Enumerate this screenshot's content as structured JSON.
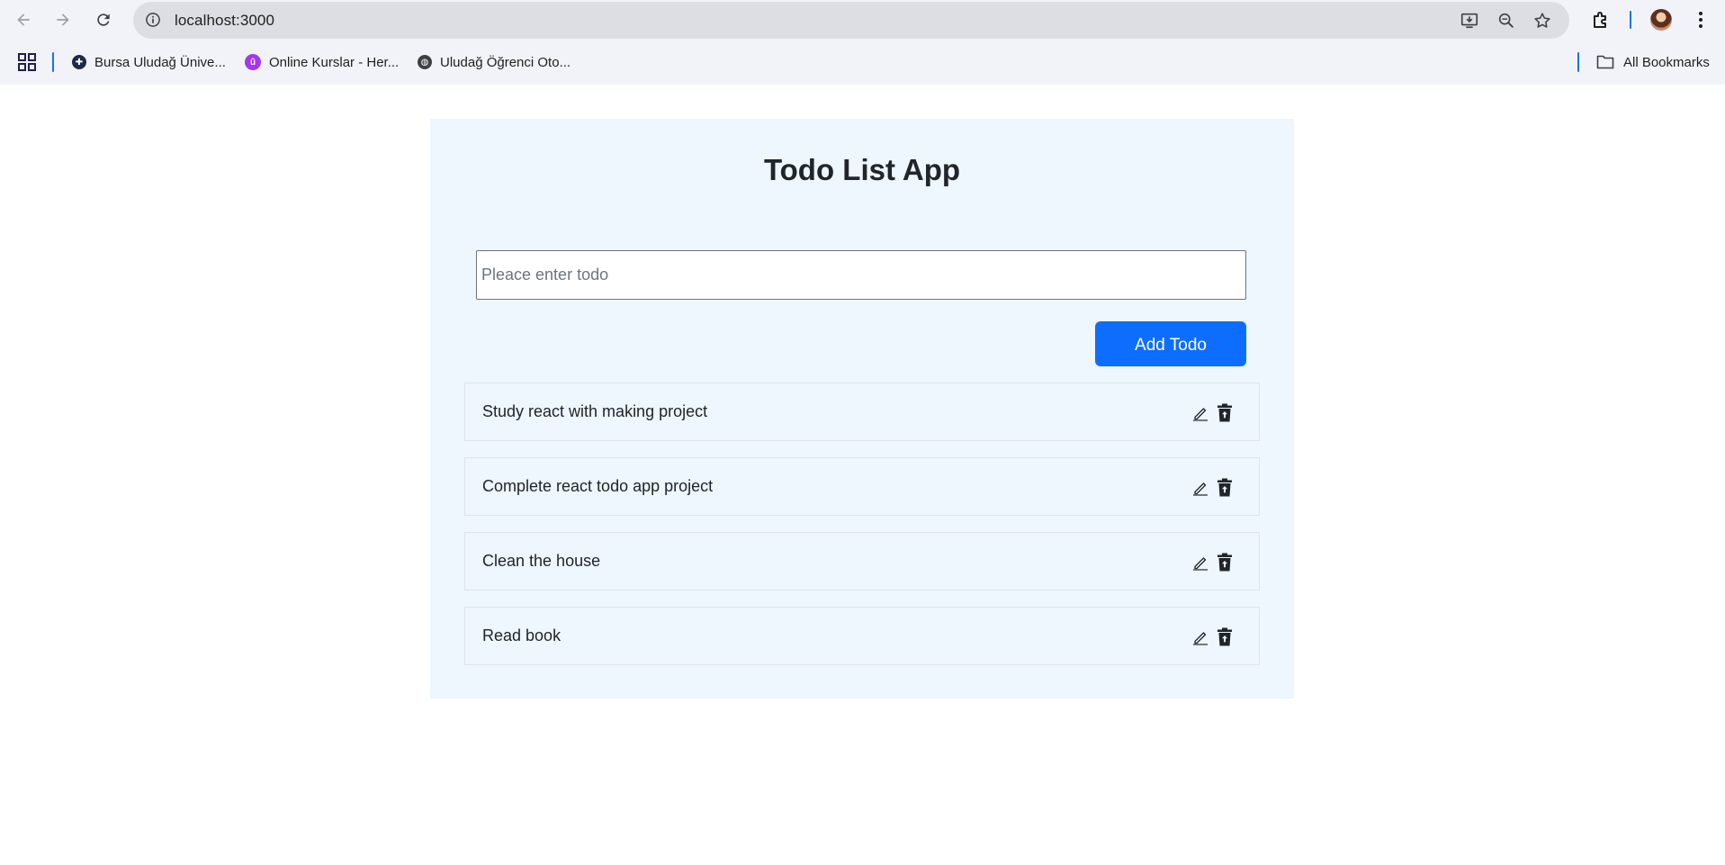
{
  "browser": {
    "url": "localhost:3000",
    "bookmarks": [
      {
        "label": "Bursa Uludağ Ünive...",
        "icon": "uludag-favicon"
      },
      {
        "label": "Online Kurslar - Her...",
        "icon": "udemy-favicon"
      },
      {
        "label": "Uludağ Öğrenci Oto...",
        "icon": "globe-favicon"
      }
    ],
    "all_bookmarks_label": "All Bookmarks"
  },
  "app": {
    "title": "Todo List App",
    "input_placeholder": "Pleace enter todo",
    "input_value": "",
    "add_button_label": "Add Todo",
    "accent_color": "#0d6efd",
    "todos": [
      {
        "text": "Study react with making project"
      },
      {
        "text": "Complete react todo app project"
      },
      {
        "text": "Clean the house"
      },
      {
        "text": "Read book"
      }
    ]
  }
}
